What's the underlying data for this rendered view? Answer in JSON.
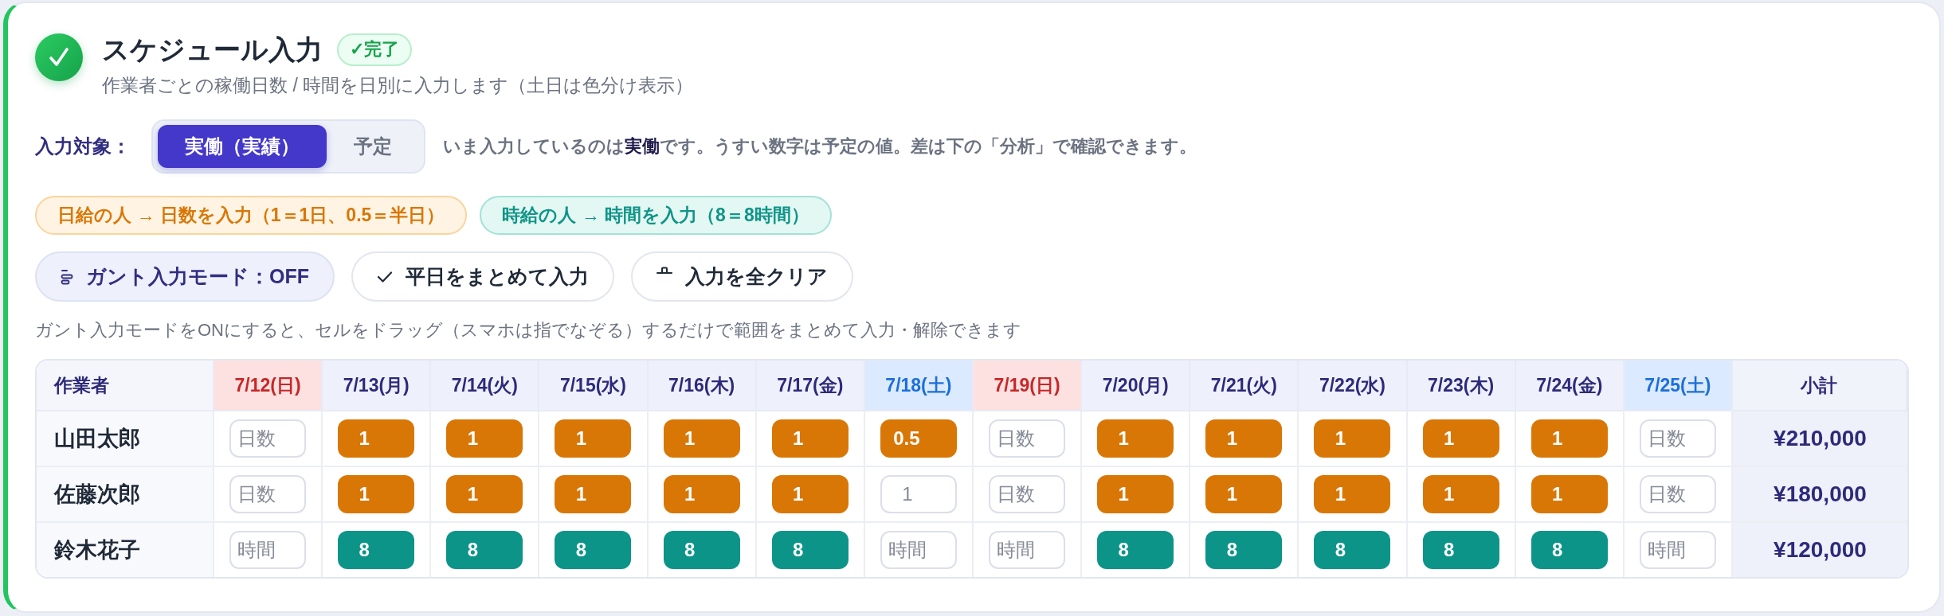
{
  "header": {
    "title": "スケジュール入力",
    "badge": "✓完了",
    "subtitle": "作業者ごとの稼働日数 / 時間を日別に入力します（土日は色分け表示）"
  },
  "target": {
    "label": "入力対象：",
    "options": [
      {
        "label": "実働（実績）",
        "selected": true
      },
      {
        "label": "予定",
        "selected": false
      }
    ],
    "note": "いま入力しているのは**実働**です。うすい数字は予定の値。差は下の「分析」で確認できます。"
  },
  "chips": [
    {
      "label": "日給の人 → 日数を入力（1＝1日、0.5＝半日）",
      "kind": "daily"
    },
    {
      "label": "時給の人 → 時間を入力（8＝8時間）",
      "kind": "hourly"
    }
  ],
  "buttons": [
    {
      "label": "ガント入力モード：OFF",
      "kind": "toggle"
    },
    {
      "label": "平日をまとめて入力",
      "kind": "bulk"
    },
    {
      "label": "入力を全クリア",
      "kind": "clear"
    }
  ],
  "hint": "ガント入力モードをONにすると、セルをドラッグ（スマホは指でなぞる）するだけで範囲をまとめて入力・解除できます",
  "table": {
    "columns": [
      {
        "label": "作業者",
        "kind": "name"
      },
      {
        "label": "7/12(日)",
        "kind": "sunday"
      },
      {
        "label": "7/13(月)",
        "kind": "weekday"
      },
      {
        "label": "7/14(火)",
        "kind": "weekday"
      },
      {
        "label": "7/15(水)",
        "kind": "weekday"
      },
      {
        "label": "7/16(木)",
        "kind": "weekday"
      },
      {
        "label": "7/17(金)",
        "kind": "weekday"
      },
      {
        "label": "7/18(土)",
        "kind": "saturday"
      },
      {
        "label": "7/19(日)",
        "kind": "sunday"
      },
      {
        "label": "7/20(月)",
        "kind": "weekday"
      },
      {
        "label": "7/21(火)",
        "kind": "weekday"
      },
      {
        "label": "7/22(水)",
        "kind": "weekday"
      },
      {
        "label": "7/23(木)",
        "kind": "weekday"
      },
      {
        "label": "7/24(金)",
        "kind": "weekday"
      },
      {
        "label": "7/25(土)",
        "kind": "saturday"
      },
      {
        "label": "小計",
        "kind": "total"
      }
    ],
    "rows": [
      {
        "kind": "daily",
        "cells": [
          {
            "text": "山田太郎"
          },
          {
            "placeholder": "日数"
          },
          {
            "value": "1"
          },
          {
            "value": "1"
          },
          {
            "value": "1"
          },
          {
            "value": "1"
          },
          {
            "value": "1"
          },
          {
            "value": "0.5"
          },
          {
            "placeholder": "日数"
          },
          {
            "value": "1"
          },
          {
            "value": "1"
          },
          {
            "value": "1"
          },
          {
            "value": "1"
          },
          {
            "value": "1"
          },
          {
            "placeholder": "日数"
          },
          {
            "text": "¥210,000"
          }
        ]
      },
      {
        "kind": "daily",
        "cells": [
          {
            "text": "佐藤次郎"
          },
          {
            "placeholder": "日数"
          },
          {
            "value": "1"
          },
          {
            "value": "1"
          },
          {
            "value": "1"
          },
          {
            "value": "1"
          },
          {
            "value": "1"
          },
          {
            "placeholder": "1"
          },
          {
            "placeholder": "日数"
          },
          {
            "value": "1"
          },
          {
            "value": "1"
          },
          {
            "value": "1"
          },
          {
            "value": "1"
          },
          {
            "value": "1"
          },
          {
            "placeholder": "日数"
          },
          {
            "text": "¥180,000"
          }
        ]
      },
      {
        "kind": "hourly",
        "cells": [
          {
            "text": "鈴木花子"
          },
          {
            "placeholder": "時間"
          },
          {
            "value": "8"
          },
          {
            "value": "8"
          },
          {
            "value": "8"
          },
          {
            "value": "8"
          },
          {
            "value": "8"
          },
          {
            "placeholder": "時間"
          },
          {
            "placeholder": "時間"
          },
          {
            "value": "8"
          },
          {
            "value": "8"
          },
          {
            "value": "8"
          },
          {
            "value": "8"
          },
          {
            "value": "8"
          },
          {
            "placeholder": "時間"
          },
          {
            "text": "¥120,000"
          }
        ]
      }
    ]
  }
}
